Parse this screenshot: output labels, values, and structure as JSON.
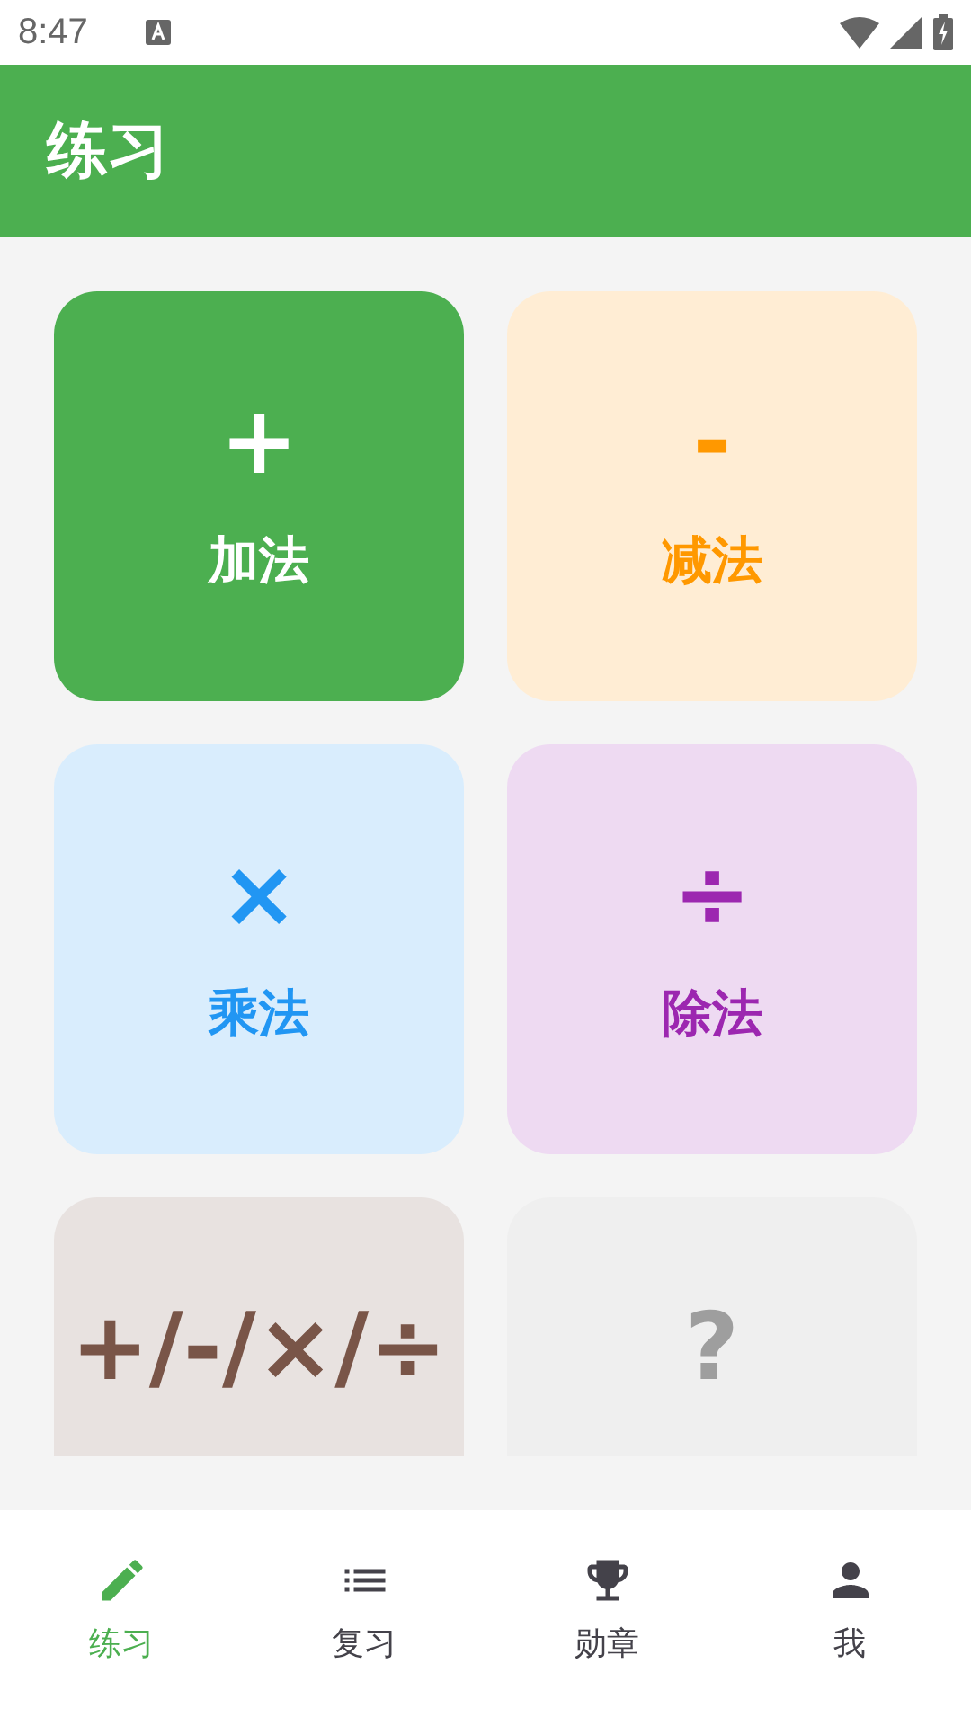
{
  "status_bar": {
    "time": "8:47"
  },
  "app_bar": {
    "title": "练习"
  },
  "cards": [
    {
      "symbol": "+",
      "label": "加法",
      "color": "#4caf50",
      "selected": true
    },
    {
      "symbol": "-",
      "label": "减法",
      "color": "#ff9800",
      "selected": false
    },
    {
      "symbol": "×",
      "label": "乘法",
      "color": "#2196f3",
      "selected": false
    },
    {
      "symbol": "÷",
      "label": "除法",
      "color": "#9c27b0",
      "selected": false
    },
    {
      "symbol": "+/-/×/÷",
      "color": "#795548",
      "selected": false
    },
    {
      "symbol": "?",
      "color": "#9e9e9e",
      "selected": false
    }
  ],
  "bottom_nav": [
    {
      "label": "练习",
      "selected": true
    },
    {
      "label": "复习",
      "selected": false
    },
    {
      "label": "勋章",
      "selected": false
    },
    {
      "label": "我",
      "selected": false
    }
  ]
}
